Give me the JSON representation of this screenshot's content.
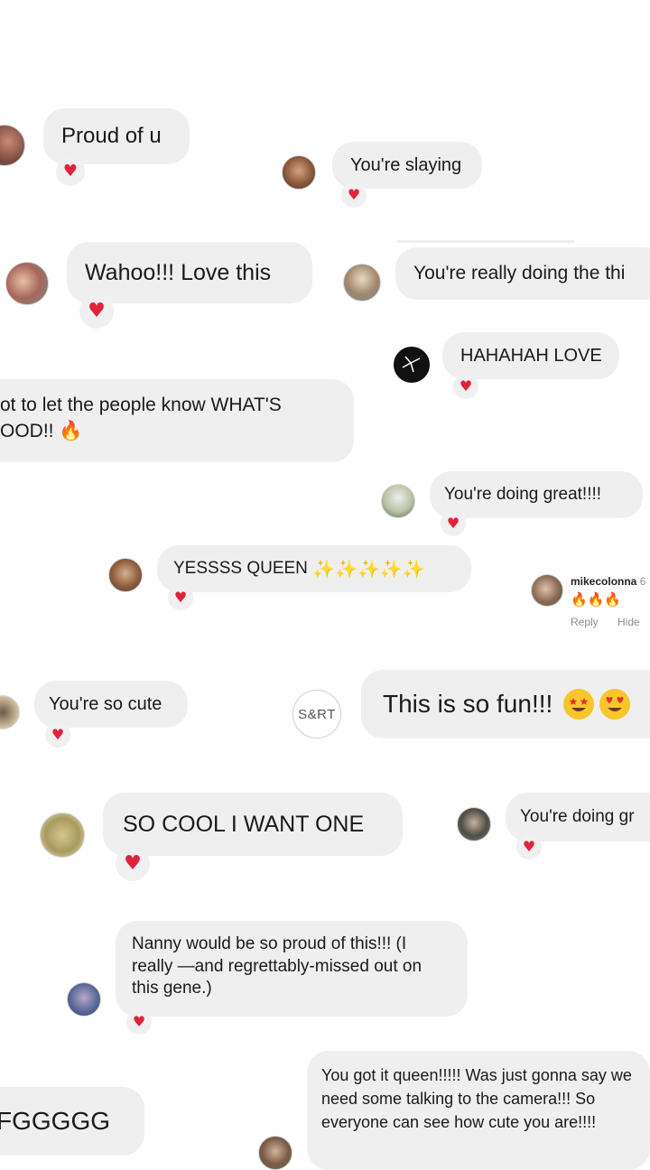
{
  "comments": [
    {
      "id": "c1",
      "text": "Proud of u"
    },
    {
      "id": "c2",
      "text": "You're slaying"
    },
    {
      "id": "c3",
      "text": "Wahoo!!! Love this"
    },
    {
      "id": "c4",
      "text": "You're really doing the thi"
    },
    {
      "id": "c5",
      "text": "HAHAHAH LOVE"
    },
    {
      "id": "c6a",
      "text": "ot to let the people know WHAT'S"
    },
    {
      "id": "c6b",
      "text": "OOD!!"
    },
    {
      "id": "c7",
      "text": "You're doing great!!!!"
    },
    {
      "id": "c8",
      "text": "YESSSS QUEEN"
    },
    {
      "id": "c9",
      "text": "You're so cute"
    },
    {
      "id": "c10",
      "text": "This is so fun!!!"
    },
    {
      "id": "c11",
      "text": "SO COOL I WANT ONE"
    },
    {
      "id": "c12",
      "text": "You're doing gr"
    },
    {
      "id": "c13",
      "text": "Nanny would be so proud of this!!! (I really —and regrettably-missed out on this gene.)"
    },
    {
      "id": "c14",
      "text": "You got it queen!!!!! Was just gonna say we need some talking to the camera!!! So everyone can see how cute you are!!!!"
    },
    {
      "id": "c15",
      "text": "FGGGGG"
    }
  ],
  "instagram_comment": {
    "username": "mikecolonna",
    "username_suffix": "6",
    "emoji_text": "🔥🔥🔥",
    "reply_label": "Reply",
    "hide_label": "Hide"
  },
  "logo": {
    "text": "S&RT"
  },
  "icons": {
    "heart": "heart-reaction-icon",
    "sparkles": "sparkles-emoji",
    "fire": "fire-emoji",
    "star_struck": "star-struck-emoji",
    "heart_eyes": "heart-eyes-emoji"
  },
  "glyphs": {
    "heart": "♥",
    "sparkle": "✨",
    "fire": "🔥"
  },
  "colors": {
    "bubble": "#efefef",
    "heart": "#e0233a",
    "meta": "#8e8e8e"
  }
}
